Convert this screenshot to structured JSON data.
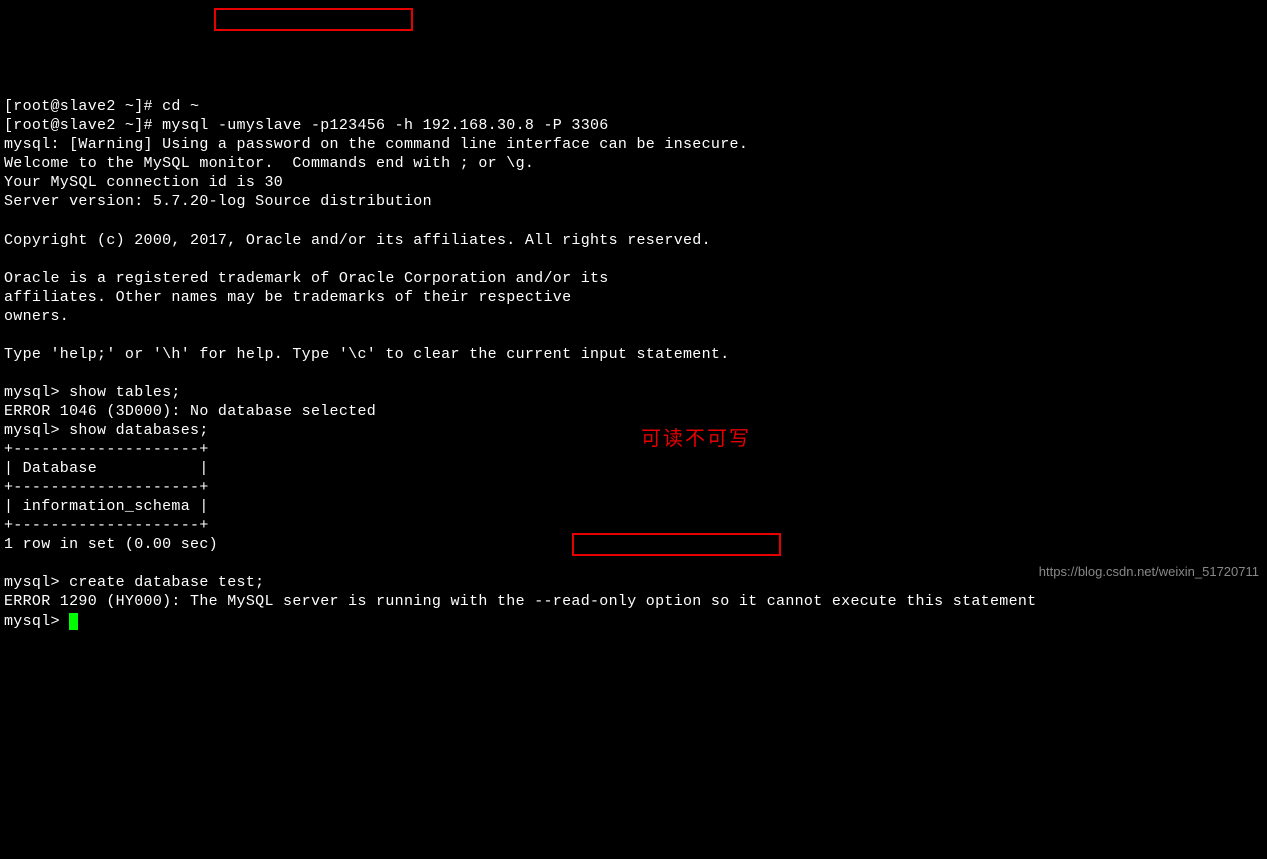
{
  "terminal": {
    "line0": "[root@slave2 ~]# cd ~",
    "line1_prefix": "[root@slave2 ~]# mysql ",
    "line1_highlight": "-umyslave -p123456 ",
    "line1_suffix": "-h 192.168.30.8 -P 3306",
    "line2": "mysql: [Warning] Using a password on the command line interface can be insecure.",
    "line3": "Welcome to the MySQL monitor.  Commands end with ; or \\g.",
    "line4": "Your MySQL connection id is 30",
    "line5": "Server version: 5.7.20-log Source distribution",
    "line6": "",
    "line7": "Copyright (c) 2000, 2017, Oracle and/or its affiliates. All rights reserved.",
    "line8": "",
    "line9": "Oracle is a registered trademark of Oracle Corporation and/or its",
    "line10": "affiliates. Other names may be trademarks of their respective",
    "line11": "owners.",
    "line12": "",
    "line13": "Type 'help;' or '\\h' for help. Type '\\c' to clear the current input statement.",
    "line14": "",
    "line15": "mysql> show tables;",
    "line16": "ERROR 1046 (3D000): No database selected",
    "line17": "mysql> show databases;",
    "line18": "+--------------------+",
    "line19": "| Database           |",
    "line20": "+--------------------+",
    "line21": "| information_schema |",
    "line22": "+--------------------+",
    "line23": "1 row in set (0.00 sec)",
    "line24": "",
    "line25": "mysql> create database test;",
    "line26_prefix": "ERROR 1290 (HY000): The MySQL server is running with the ",
    "line26_highlight": "--read-only option s",
    "line26_suffix": "o it cannot execute this statement",
    "line27": "mysql> "
  },
  "annotation": {
    "red_label": "可读不可写"
  },
  "watermark": "https://blog.csdn.net/weixin_51720711"
}
